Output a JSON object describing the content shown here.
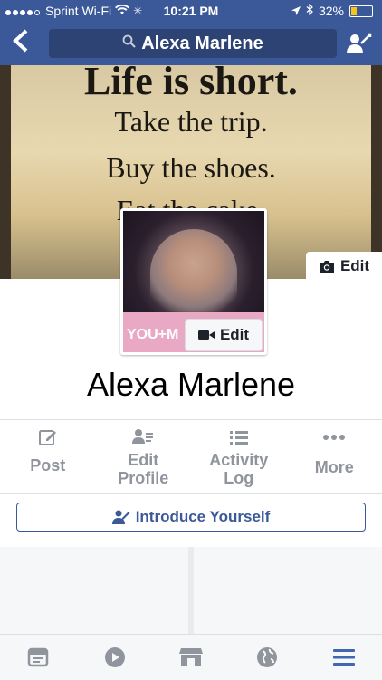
{
  "status_bar": {
    "carrier": "Sprint Wi-Fi",
    "time": "10:21 PM",
    "battery_percent": "32%",
    "battery_level": 0.32
  },
  "nav": {
    "search_text": "Alexa Marlene"
  },
  "cover": {
    "line1": "Life is short.",
    "line2": "Take the trip.",
    "line3": "Buy the shoes.",
    "line4": "Eat the cake.",
    "edit_label": "Edit"
  },
  "profile": {
    "photo_overlay": "YOU+M",
    "edit_label": "Edit",
    "name": "Alexa Marlene"
  },
  "actions": [
    {
      "label": "Post",
      "icon": "compose-icon"
    },
    {
      "label": "Edit\nProfile",
      "icon": "profile-card-icon"
    },
    {
      "label": "Activity\nLog",
      "icon": "list-icon"
    },
    {
      "label": "More",
      "icon": "more-dots-icon"
    }
  ],
  "introduce": {
    "label": "Introduce Yourself"
  },
  "tabs": [
    {
      "icon": "news-feed-icon"
    },
    {
      "icon": "video-icon"
    },
    {
      "icon": "marketplace-icon"
    },
    {
      "icon": "globe-icon"
    },
    {
      "icon": "menu-icon"
    }
  ],
  "colors": {
    "brand": "#3b5998",
    "muted": "#90949c",
    "tab_active": "#4267b2",
    "tab_inactive": "#90949c"
  }
}
